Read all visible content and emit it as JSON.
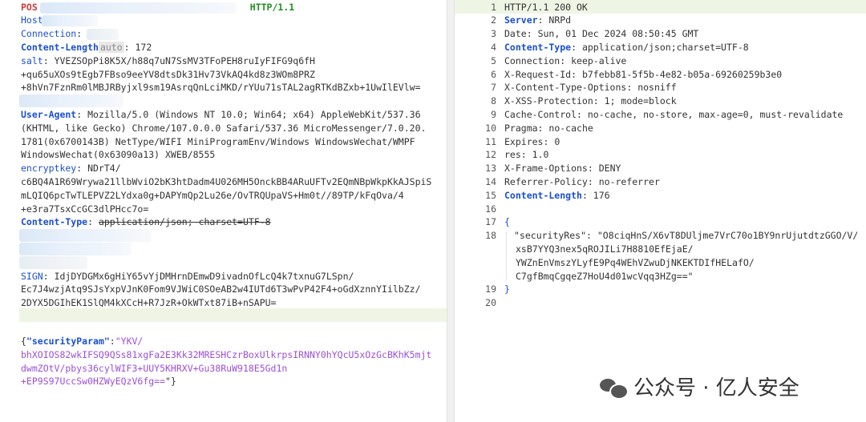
{
  "request": {
    "lines": [
      {
        "key": "POS",
        "sep": "",
        "val": "",
        "tail": "HTTP/1.1"
      },
      {
        "key": "Host",
        "sep": "",
        "val": ""
      },
      {
        "key": "Connection",
        "sep": ": ",
        "val": "k"
      },
      {
        "key": "Content-Length",
        "sep": "",
        "chip": "auto",
        "val": ": 172"
      },
      {
        "key": "salt",
        "sep": ": ",
        "val": "YVEZSOpPi8K5X/h88q7uN7SsMV3TFoPEH8ruIyFIFG9q6fH"
      },
      {
        "key": "",
        "sep": "",
        "val": "+qu65uXOs9tEgb7FBso9eeYV8dtsDk31Hv73VkAQ4kd8z3WOm8PRZ"
      },
      {
        "key": "",
        "sep": "",
        "val": "+8hVn7FznRm0lMBJRByjxl9sm19AsrqQnLciMKD/rYUu71sTAL2agRTKdBZxb+1UwIlEVlw="
      },
      {
        "key": "",
        "sep": "",
        "val": ""
      },
      {
        "key": "User-Agent",
        "sep": ": ",
        "val": "Mozilla/5.0 (Windows NT 10.0; Win64; x64) AppleWebKit/537.36"
      },
      {
        "key": "",
        "sep": "",
        "val": "(KHTML, like Gecko) Chrome/107.0.0.0 Safari/537.36 MicroMessenger/7.0.20."
      },
      {
        "key": "",
        "sep": "",
        "val": "1781(0x6700143B) NetType/WIFI MiniProgramEnv/Windows WindowsWechat/WMPF"
      },
      {
        "key": "",
        "sep": "",
        "val": "WindowsWechat(0x63090a13) XWEB/8555"
      },
      {
        "key": "encryptkey",
        "sep": ": ",
        "val": "NDrT4/"
      },
      {
        "key": "",
        "sep": "",
        "val": "c6BQ4A1R69Wrywa21llbWviO2bK3htDadm4U026MH5OnckBB4ARuUFTv2EQmNBpWkpKkAJSpiS"
      },
      {
        "key": "",
        "sep": "",
        "val": "mLQIQ6pcTwTLEPVZ2LYdxa0g+DAPYmQp2Lu26e/OvTRQUpaVS+Hm0t//89TP/kFqOva/4"
      },
      {
        "key": "",
        "sep": "",
        "val": "+e3ra7TsxCcGC3dlPHcc7o="
      },
      {
        "key": "Content-Type",
        "sep": ": ",
        "val": "application/json; charset=UTF-8",
        "strike": true
      },
      {
        "key": "",
        "sep": "",
        "val": ""
      },
      {
        "key": "",
        "sep": "",
        "val": ""
      },
      {
        "key": "",
        "sep": "",
        "val": ""
      },
      {
        "key": "SIGN",
        "sep": ": ",
        "val": "IdjDYDGMx6gHiY65vYjDMHrnDEmwD9ivadnOfLcQ4k7txnuG7LSpn/"
      },
      {
        "key": "",
        "sep": "",
        "val": "Ec7J4wzjAtq9SJsYxpVJnK0Fom9VJWiC0SOeAB2w4IUTd6T3wPvP42F4+oGdXznnYIilbZz/"
      },
      {
        "key": "",
        "sep": "",
        "val": "2DYX5DGIhEK1SlQM4kXCcH+R7JzR+OkWTxt87iB+nSAPU="
      }
    ],
    "body_key": "\"securityParam\"",
    "body_lines": [
      "\"YKV/",
      "bhXOIOS82wkIFSQ9QSs81xgFa2E3Kk32MRESHCzrBoxUlkrpsIRNNY0hYQcU5xOzGcBKhK5mjt",
      "dwmZOtV/pbys36cylWIF3+UUY5KHRXV+Gu38RuW918E5Gd1n",
      "+EP9S97UccSw0HZWyEQzV6fg=="
    ],
    "body_open": "{",
    "body_colon": ":",
    "body_close": "\"}"
  },
  "response": {
    "line_numbers": [
      "1",
      "2",
      "3",
      "4",
      "5",
      "6",
      "7",
      "8",
      "9",
      "10",
      "11",
      "12",
      "13",
      "14",
      "15",
      "16",
      "17",
      "18",
      "",
      "",
      "",
      "19",
      "20"
    ],
    "status_line": "HTTP/1.1 200 OK",
    "headers": [
      {
        "key": "Server",
        "val": "NRPd",
        "bold": true
      },
      {
        "key": "Date",
        "val": "Sun, 01 Dec 2024 08:50:45 GMT"
      },
      {
        "key": "Content-Type",
        "val": "application/json;charset=UTF-8",
        "bold": true
      },
      {
        "key": "Connection",
        "val": "keep-alive"
      },
      {
        "key": "X-Request-Id",
        "val": "b7febb81-5f5b-4e82-b05a-69260259b3e0"
      },
      {
        "key": "X-Content-Type-Options",
        "val": "nosniff"
      },
      {
        "key": "X-XSS-Protection",
        "val": "1; mode=block"
      },
      {
        "key": "Cache-Control",
        "val": "no-cache, no-store, max-age=0, must-revalidate"
      },
      {
        "key": "Pragma",
        "val": "no-cache"
      },
      {
        "key": "Expires",
        "val": "0"
      },
      {
        "key": "res",
        "val": "1.0"
      },
      {
        "key": "X-Frame-Options",
        "val": "DENY"
      },
      {
        "key": "Referrer-Policy",
        "val": "no-referrer"
      },
      {
        "key": "Content-Length",
        "val": "176",
        "bold": true
      }
    ],
    "json_open": "{",
    "json_key": "\"securityRes\"",
    "json_value_lines": [
      "\"O8ciqHnS/X6vT8DUljme7VrC70o1BY9nrUjutdtzGGO/V/",
      "xsB7YYQ3nex5qROJILi7H8810EfEjaE/",
      "YWZnEnVmszYLyfE9Pq4WEhVZwuDjNKEKTDIfHELafO/",
      "C7gfBmqCgqeZ7HoU4d01wcVqq3HZg==\""
    ],
    "json_close": "}"
  },
  "watermark": {
    "text": "公众号 · 亿人安全",
    "icon": "wechat-icon"
  }
}
